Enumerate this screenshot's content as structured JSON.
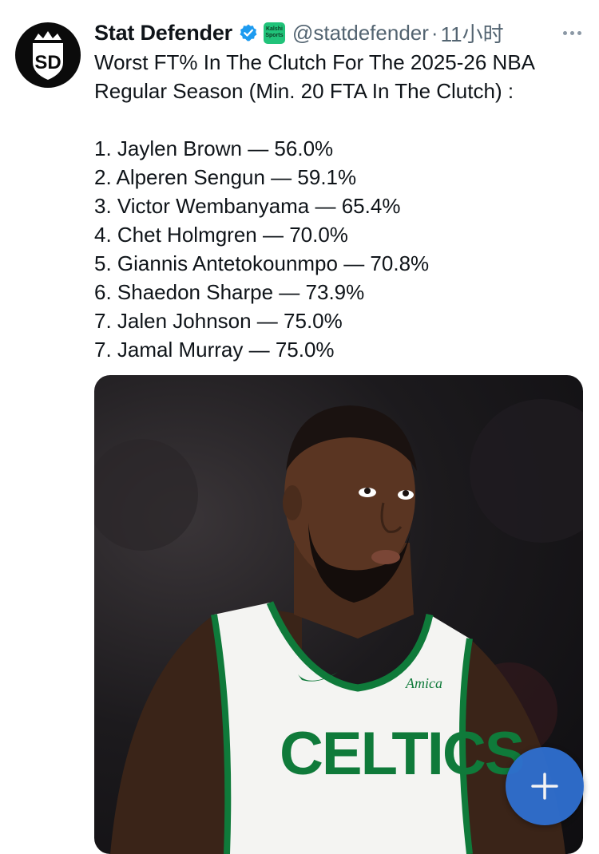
{
  "tweet": {
    "author": {
      "display_name": "Stat Defender",
      "handle": "@statdefender",
      "avatar_text": "SD",
      "verified": true,
      "affiliate_badge_text": "Kalshi Sports"
    },
    "time_separator": "·",
    "time": "11小时",
    "headline": "Worst FT% In The Clutch For The 2025-26 NBA Regular Season (Min. 20 FTA In The Clutch) :",
    "list": [
      "1.  Jaylen Brown — 56.0%",
      "2.  Alperen Sengun — 59.1%",
      "3.  Victor Wembanyama — 65.4%",
      "4.  Chet Holmgren — 70.0%",
      "5.  Giannis Antetokounmpo — 70.8%",
      "6.  Shaedon Sharpe — 73.9%",
      "7.  Jalen Johnson — 75.0%",
      "7.  Jamal Murray — 75.0%"
    ],
    "media": {
      "jersey_text": "CELTICS",
      "sponsor_text": "Amica"
    }
  },
  "icons": {
    "verified": "verified-badge-icon",
    "more": "more-dots-icon",
    "compose": "plus-icon"
  },
  "colors": {
    "verified_blue": "#1d9bf0",
    "affiliate_green": "#21c37a",
    "secondary_text": "#536471",
    "fab_blue": "#2f6fd0",
    "jersey_green": "#0f7a3a"
  }
}
